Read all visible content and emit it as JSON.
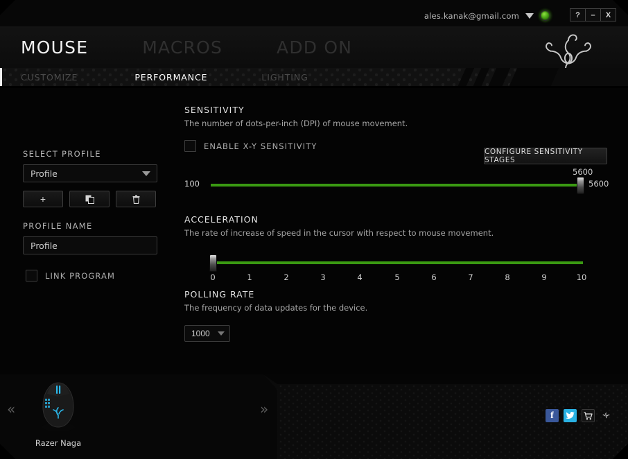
{
  "titlebar": {
    "account_email": "ales.kanak@gmail.com",
    "caret_icon": "chevron-down-icon",
    "status_led_color": "#4ea517",
    "buttons": [
      {
        "name": "help-button",
        "label": "?"
      },
      {
        "name": "minimize-button",
        "label": "–"
      },
      {
        "name": "close-button",
        "label": "X"
      }
    ]
  },
  "header": {
    "main_tabs": [
      {
        "label": "MOUSE",
        "active": true
      },
      {
        "label": "MACROS",
        "active": false
      },
      {
        "label": "ADD ON",
        "active": false
      }
    ],
    "logo_icon": "razer-snakes-logo",
    "sub_tabs": [
      {
        "label": "CUSTOMIZE",
        "active": false
      },
      {
        "label": "PERFORMANCE",
        "active": true
      },
      {
        "label": "LIGHTING",
        "active": false
      }
    ]
  },
  "profile_panel": {
    "select_profile_label": "SELECT PROFILE",
    "select_profile_value": "Profile",
    "buttons": [
      {
        "name": "add-profile-button",
        "glyph": "+"
      },
      {
        "name": "copy-profile-button",
        "glyph": "❐"
      },
      {
        "name": "delete-profile-button",
        "glyph": "🗑"
      }
    ],
    "profile_name_label": "PROFILE NAME",
    "profile_name_value": "Profile",
    "link_program_label": "LINK PROGRAM",
    "link_program_checked": false
  },
  "sensitivity": {
    "title": "SENSITIVITY",
    "description": "The number of dots-per-inch (DPI) of mouse movement.",
    "enable_xy_label": "ENABLE X-Y SENSITIVITY",
    "enable_xy_checked": false,
    "configure_button_label": "CONFIGURE SENSITIVITY STAGES",
    "slider": {
      "min_label": "100",
      "value_label": "5600",
      "top_label": "5600",
      "min": 100,
      "max": 5600,
      "value": 5600,
      "fill_color": "#3a9a12"
    }
  },
  "acceleration": {
    "title": "ACCELERATION",
    "description": "The rate of increase of speed in the cursor with respect to mouse movement.",
    "slider": {
      "min": 0,
      "max": 10,
      "value": 0,
      "ticks": [
        "0",
        "1",
        "2",
        "3",
        "4",
        "5",
        "6",
        "7",
        "8",
        "9",
        "10"
      ],
      "fill_color": "#3a9a12"
    }
  },
  "polling_rate": {
    "title": "POLLING RATE",
    "description": "The frequency of data updates for the device.",
    "value": "1000"
  },
  "device_bar": {
    "prev_label": "«",
    "next_label": "»",
    "device_name": "Razer Naga",
    "device_icon": "razer-naga-mouse",
    "social": [
      {
        "name": "facebook-icon",
        "label": "f"
      },
      {
        "name": "twitter-icon",
        "label": ""
      },
      {
        "name": "cart-icon",
        "label": ""
      },
      {
        "name": "razer-icon",
        "label": ""
      }
    ]
  }
}
